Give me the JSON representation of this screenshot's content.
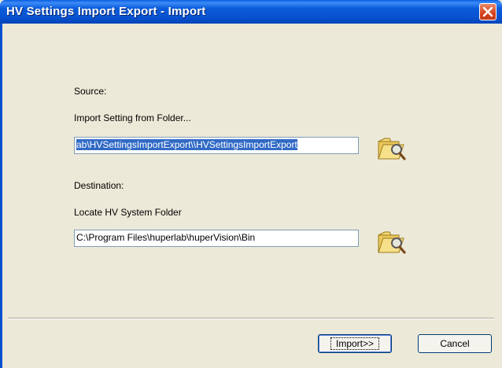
{
  "window": {
    "title": "HV Settings Import Export - Import"
  },
  "source": {
    "heading": "Source:",
    "label": "Import Setting from Folder...",
    "path_value": "ab\\HVSettingsImportExport\\\\HVSettingsImportExport"
  },
  "destination": {
    "heading": "Destination:",
    "label": "Locate HV System Folder",
    "path_value": "C:\\Program Files\\huperlab\\huperVision\\Bin"
  },
  "buttons": {
    "import_label": "Import>>",
    "cancel_label": "Cancel"
  },
  "icons": {
    "close": "close-icon",
    "browse": "folder-search-icon"
  }
}
